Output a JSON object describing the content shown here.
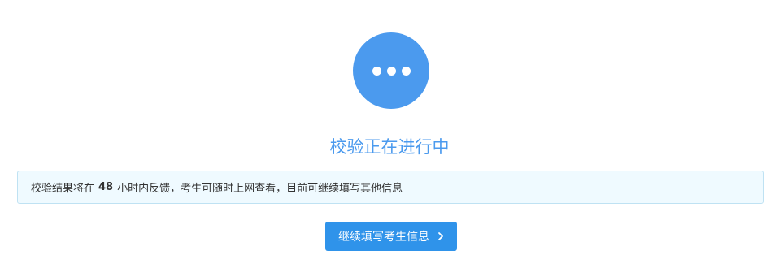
{
  "status": {
    "icon": "more-dots-icon",
    "color": "#4b9aee"
  },
  "title": "校验正在进行中",
  "notice": {
    "prefix": "校验结果将在",
    "hours": "48",
    "suffix": "小时内反馈，考生可随时上网查看，目前可继续填写其他信息"
  },
  "action": {
    "continue_label": "继续填写考生信息",
    "icon": "chevron-right-icon",
    "color": "#2f93ea"
  }
}
